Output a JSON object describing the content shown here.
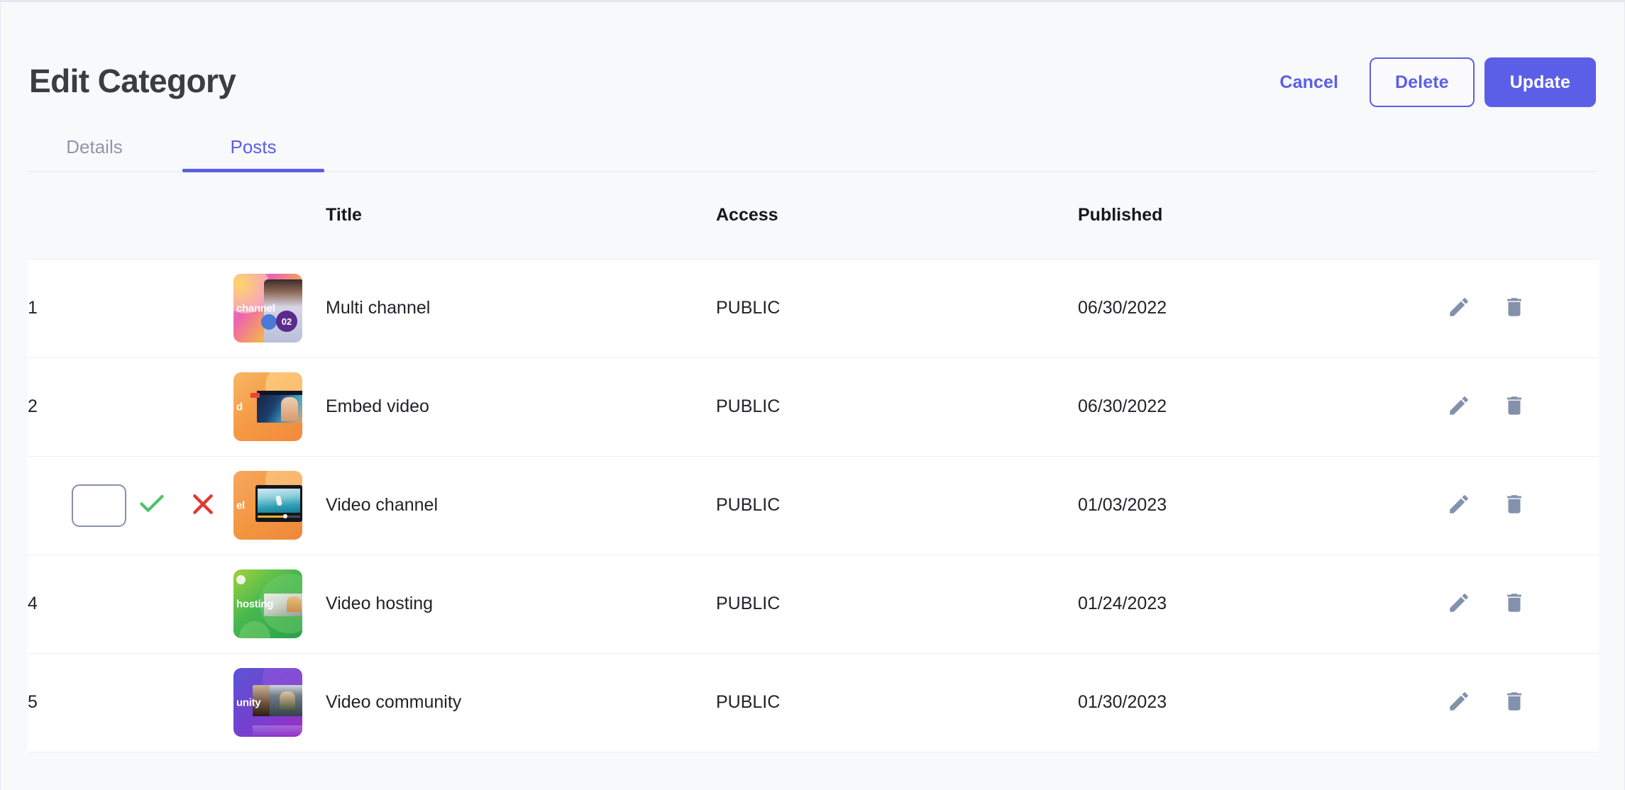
{
  "header": {
    "title": "Edit Category",
    "buttons": {
      "cancel": "Cancel",
      "delete": "Delete",
      "update": "Update"
    }
  },
  "tabs": [
    {
      "label": "Details",
      "active": false
    },
    {
      "label": "Posts",
      "active": true
    }
  ],
  "table": {
    "columns": {
      "number": "",
      "thumbnail": "",
      "title": "Title",
      "access": "Access",
      "published": "Published",
      "actions": ""
    },
    "rows": [
      {
        "number": "1",
        "editing": false,
        "thumb_label": "channel",
        "thumb_class": "th1",
        "title": "Multi channel",
        "access": "PUBLIC",
        "published": "06/30/2022"
      },
      {
        "number": "2",
        "editing": false,
        "thumb_label": "d",
        "thumb_class": "th2",
        "title": "Embed video",
        "access": "PUBLIC",
        "published": "06/30/2022"
      },
      {
        "number": "",
        "editing": true,
        "edit_value": "",
        "thumb_label": "el",
        "thumb_class": "th3",
        "title": "Video channel",
        "access": "PUBLIC",
        "published": "01/03/2023"
      },
      {
        "number": "4",
        "editing": false,
        "thumb_label": "hosting",
        "thumb_class": "th4",
        "title": "Video hosting",
        "access": "PUBLIC",
        "published": "01/24/2023"
      },
      {
        "number": "5",
        "editing": false,
        "thumb_label": "unity",
        "thumb_class": "th5",
        "title": "Video community",
        "access": "PUBLIC",
        "published": "01/30/2023"
      }
    ]
  },
  "colors": {
    "accent": "#5b5fe8",
    "page_bg": "#f8f9fb",
    "row_bg": "#ffffff",
    "border": "#edeff5",
    "title_text": "#3c3c43",
    "muted_text": "#9296ab",
    "action_icon": "#8491ad",
    "confirm_green": "#4cc36a",
    "cancel_red": "#e03a30",
    "input_border": "#8791ab"
  },
  "badges": {
    "thumb1_episode": "02"
  }
}
